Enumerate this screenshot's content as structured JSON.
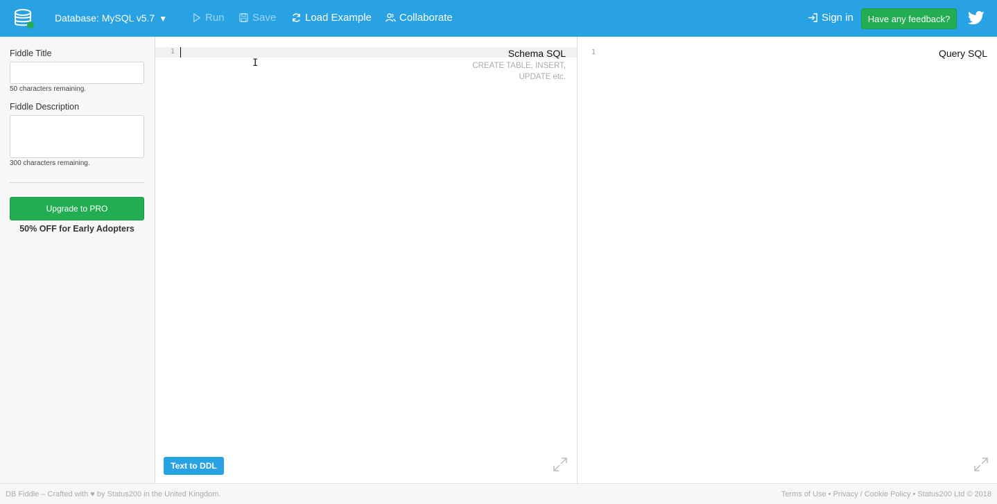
{
  "header": {
    "database_label": "Database: MySQL v5.7",
    "run_label": "Run",
    "save_label": "Save",
    "load_example_label": "Load Example",
    "collaborate_label": "Collaborate",
    "sign_in_label": "Sign in",
    "feedback_label": "Have any feedback?"
  },
  "sidebar": {
    "title_label": "Fiddle Title",
    "title_value": "",
    "title_remaining": "50 characters remaining.",
    "description_label": "Fiddle Description",
    "description_value": "",
    "description_remaining": "300 characters remaining.",
    "upgrade_label": "Upgrade to PRO",
    "promo_text": "50% OFF for Early Adopters"
  },
  "schema_editor": {
    "line_number": "1",
    "title": "Schema SQL",
    "hint": "CREATE TABLE, INSERT, UPDATE etc.",
    "text_to_ddl_label": "Text to DDL"
  },
  "query_editor": {
    "line_number": "1",
    "title": "Query SQL"
  },
  "footer": {
    "credit_prefix": "DB Fiddle – Crafted with ♥ by ",
    "credit_company": "Status200",
    "credit_mid": " in the ",
    "credit_country": "United Kingdom",
    "credit_end": ".",
    "terms_label": "Terms of Use",
    "separator": " • ",
    "privacy_label": "Privacy / Cookie Policy",
    "copyright": "Status200 Ltd © 2018"
  },
  "colors": {
    "header_bg": "#28a2e3",
    "accent_green": "#22ad52",
    "ddl_button_bg": "#28a2e3"
  },
  "icons": [
    "database-logo-icon",
    "caret-down-icon",
    "play-icon",
    "save-icon",
    "refresh-icon",
    "users-icon",
    "sign-in-icon",
    "twitter-icon",
    "expand-icon"
  ]
}
